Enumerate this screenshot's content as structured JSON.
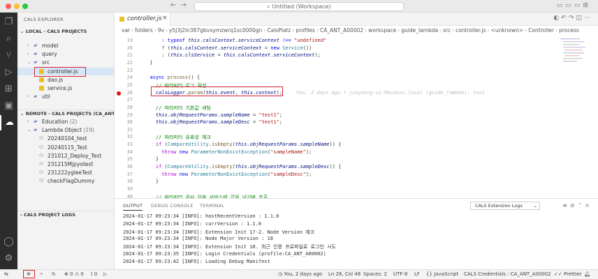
{
  "window": {
    "title": "Untitled (Workspace)",
    "traffic_colors": [
      "#ff5f57",
      "#febc2e",
      "#28c840"
    ]
  },
  "sidebar": {
    "title": "CALS EXPLORER",
    "local_section": {
      "title": "LOCAL - CALS PROJECTS",
      "items": [
        {
          "label": "model",
          "type": "folder",
          "depth": 1
        },
        {
          "label": "query",
          "type": "folder",
          "depth": 1
        },
        {
          "label": "src",
          "type": "folder-open",
          "depth": 1
        },
        {
          "label": "controller.js",
          "type": "js",
          "depth": 2,
          "selected": true
        },
        {
          "label": "dao.js",
          "type": "js",
          "depth": 2
        },
        {
          "label": "service.js",
          "type": "js",
          "depth": 2
        },
        {
          "label": "util",
          "type": "folder",
          "depth": 1
        }
      ]
    },
    "remote_section": {
      "title": "REMOTE - CALS PROJECTS (CA_ANT...",
      "items": [
        {
          "label": "Education",
          "count": "(2)",
          "type": "folder",
          "depth": 1
        },
        {
          "label": "Lambda Object",
          "count": "(19)",
          "type": "folder-open",
          "depth": 1
        },
        {
          "label": "20240104_test",
          "type": "user",
          "depth": 2
        },
        {
          "label": "20240115_Test",
          "type": "user",
          "depth": 2
        },
        {
          "label": "231012_Deploy_Test",
          "type": "user",
          "depth": 2
        },
        {
          "label": "231215Mjpyotest",
          "type": "user",
          "depth": 2
        },
        {
          "label": "231222ygleeTest",
          "type": "user",
          "depth": 2
        },
        {
          "label": "checkFlagDummy",
          "type": "user",
          "depth": 2
        }
      ]
    },
    "logs_section": {
      "title": "CALS PROJECT LOGS"
    }
  },
  "editor": {
    "tab_label": "controller.js",
    "breadcrumb": [
      "var",
      "folders",
      "9v",
      "y5j3j2ln387gbvxymzwrq1sc0000gn",
      "CalsPlatz",
      "profiles",
      "CA_ANT_A00002",
      "workspace",
      "guide_lambda",
      "src",
      "controller.js",
      "<unknown>",
      "Controller",
      "process"
    ],
    "lines": [
      {
        "n": "19",
        "html": "      <span class='c-kw'>:</span> <span class='c-kw'>typeof</span> <span class='c-var'>this</span>.<span class='c-var'>calsContext</span>.<span class='c-var'>serviceContext</span> <span class='c-kw'>!==</span> <span class='c-str'>\"undefined\"</span>"
      },
      {
        "n": "20",
        "html": "      ? (<span class='c-var'>this</span>.<span class='c-var'>calsContext</span>.<span class='c-var'>serviceContext</span> = <span class='c-kw'>new</span> <span class='c-type'>Service</span>())"
      },
      {
        "n": "21",
        "html": "      : (<span class='c-var'>this</span>.<span class='c-var'>clsService</span> = <span class='c-var'>this</span>.<span class='c-var'>calsContext</span>.<span class='c-var'>serviceContext</span>);"
      },
      {
        "n": "22",
        "html": "  }"
      },
      {
        "n": "23",
        "html": ""
      },
      {
        "n": "24",
        "html": "  <span class='c-kw'>async</span> <span class='c-fn'>process</span>() {"
      },
      {
        "n": "25",
        "html": "    <span class='c-cmt'>// 파라미터 로그 작성</span>"
      },
      {
        "n": "26",
        "html": "    <span class='c-var'>calsLogger</span>.<span class='c-fn'>param</span>(<span class='c-var'>this</span>.<span class='c-var'>event</span>, <span class='c-var'>this</span>.<span class='c-var'>context</span>);"
      },
      {
        "n": "27",
        "html": ""
      },
      {
        "n": "28",
        "html": "    <span class='c-cmt'>// 파라미터 기본값 세팅</span>"
      },
      {
        "n": "29",
        "html": "    <span class='c-var'>this</span>.<span class='c-var'>objRequestParams</span>.<span class='c-var'>sampleName</span> = <span class='c-str'>\"test1\"</span>;"
      },
      {
        "n": "30",
        "html": "    <span class='c-var'>this</span>.<span class='c-var'>objRequestParams</span>.<span class='c-var'>sampleDesc</span> = <span class='c-str'>\"test1\"</span>;"
      },
      {
        "n": "31",
        "html": ""
      },
      {
        "n": "32",
        "html": "    <span class='c-cmt'>// 파라미터 유효성 체크</span>"
      },
      {
        "n": "33",
        "html": "    <span class='c-ctl'>if</span> (<span class='c-type'>CompareUtility</span>.<span class='c-fn'>isEmpty</span>(<span class='c-var'>this</span>.<span class='c-var'>objRequestParams</span>.<span class='c-var'>sampleName</span>)) {"
      },
      {
        "n": "34",
        "html": "      <span class='c-ctl'>throw</span> <span class='c-kw'>new</span> <span class='c-type'>ParameterNonExistException</span>(<span class='c-str'>\"sampleName\"</span>);"
      },
      {
        "n": "35",
        "html": "    }"
      },
      {
        "n": "36",
        "html": "    <span class='c-ctl'>if</span> (<span class='c-type'>CompareUtility</span>.<span class='c-fn'>isEmpty</span>(<span class='c-var'>this</span>.<span class='c-var'>objRequestParams</span>.<span class='c-var'>sampleDesc</span>)) {"
      },
      {
        "n": "37",
        "html": "      <span class='c-ctl'>throw</span> <span class='c-kw'>new</span> <span class='c-type'>ParameterNonExistException</span>(<span class='c-str'>\"sampleDesc\"</span>);"
      },
      {
        "n": "38",
        "html": "    }"
      },
      {
        "n": "39",
        "html": ""
      },
      {
        "n": "40",
        "html": "    <span class='c-cmt'>// 파라미터 검사 이후 서비스에 값을 넘기며 호출</span>"
      }
    ],
    "breakpoint_line": "26",
    "blame": "You, 2 days ago • junyeong-ui-Macmini.local (guide_lambda): test"
  },
  "panel": {
    "tabs": [
      "OUTPUT",
      "DEBUG CONSOLE",
      "TERMINAL"
    ],
    "active_tab": "OUTPUT",
    "log_source": "CALS Extension Logs",
    "lines": [
      "2024-01-17 09:23:34 [INFO]: hostRecentVersion : 1.1.0",
      "2024-01-17 09:23:34 [INFO]: currVersion : 1.1.0",
      "2024-01-17 09:23:34 [INFO]: Extension Init 17-2. Node Version 체크",
      "2024-01-17 09:23:34 [INFO]: Node Major Version : 18",
      "2024-01-17 09:23:34 [INFO]: Extension Init 18. 최근 인증 프로파일로 로그인 시도",
      "2024-01-17 09:23:35 [INFO]: Login Credentials (profile:CA_ANT_A00002)",
      "2024-01-17 09:23:42 [INFO]: Loading Debug Manifest"
    ]
  },
  "statusbar": {
    "errors": "0",
    "warnings": "0",
    "ports": "0",
    "git_blame": "You, 2 days ago",
    "cursor": "Ln 26, Col 48",
    "indent": "Spaces: 2",
    "encoding": "UTF-8",
    "eol": "LF",
    "language": "JavaScript",
    "credentials": "CALS Credentials : CA_ANT_A00002",
    "formatter": "Prettier"
  }
}
